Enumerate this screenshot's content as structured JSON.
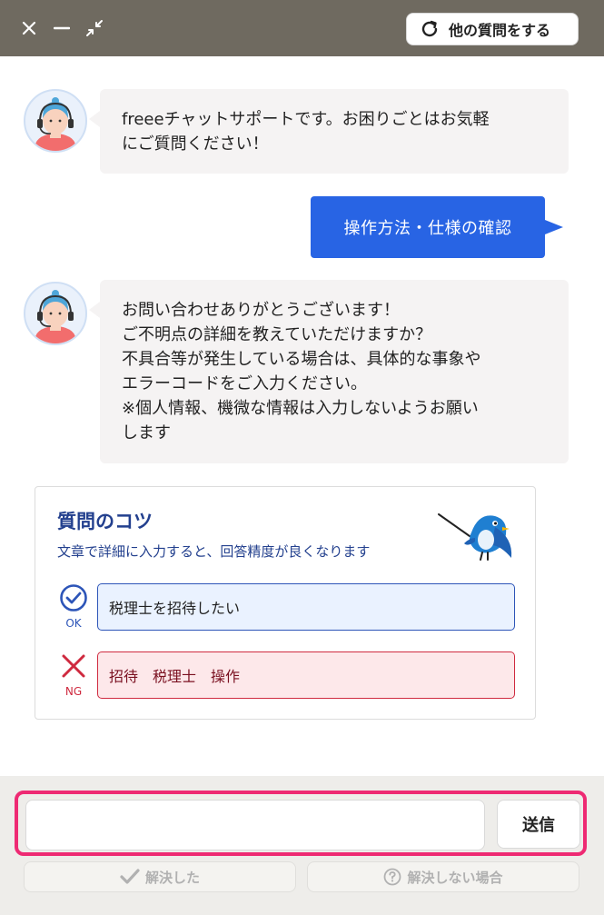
{
  "header": {
    "new_question_label": "他の質問をする"
  },
  "chat": {
    "bot_message_1": "freeeチャットサポートです。お困りごとはお気軽\nにご質問ください！",
    "user_message_1": "操作方法・仕様の確認",
    "bot_message_2": "お問い合わせありがとうございます！\nご不明点の詳細を教えていただけますか？\n不具合等が発生している場合は、具体的な事象や\nエラーコードをご入力ください。\n※個人情報、機微な情報は入力しないようお願い\nします"
  },
  "tips": {
    "title": "質問のコツ",
    "subtitle": "文章で詳細に入力すると、回答精度が良くなります",
    "ok_caption": "OK",
    "ok_example": "税理士を招待したい",
    "ng_caption": "NG",
    "ng_example": "招待　税理士　操作"
  },
  "footer": {
    "input_value": "",
    "send_label": "送信",
    "resolved_label": "解決した",
    "unresolved_label": "解決しない場合"
  },
  "colors": {
    "header_bg": "#6f6a60",
    "user_bubble": "#2864e4",
    "focus_ring": "#ee2a73",
    "ok_blue": "#2d55b8",
    "ng_red": "#cf2a3f"
  }
}
